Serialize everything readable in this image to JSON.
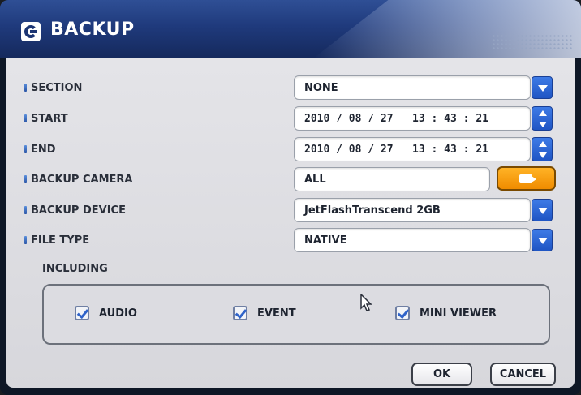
{
  "window": {
    "title": "BACKUP",
    "title_icon": "backup-app-icon",
    "accent_color": "#1f3a7c",
    "button_color": "#2a62d6",
    "camera_button_color": "#f59a0e"
  },
  "form": {
    "section": {
      "label": "SECTION",
      "value": "NONE",
      "control_icon": "chevron-down-icon"
    },
    "start": {
      "label": "START",
      "value": "2010 / 08 / 27   13 : 43 : 21",
      "control_icon": "spin-up-down-icon"
    },
    "end": {
      "label": "END",
      "value": "2010 / 08 / 27   13 : 43 : 21",
      "control_icon": "spin-up-down-icon"
    },
    "backup_camera": {
      "label": "BACKUP CAMERA",
      "value": "ALL",
      "control_icon": "camera-icon"
    },
    "backup_device": {
      "label": "BACKUP DEVICE",
      "value": "JetFlashTranscend 2GB",
      "control_icon": "chevron-down-icon"
    },
    "file_type": {
      "label": "FILE TYPE",
      "value": "NATIVE",
      "control_icon": "chevron-down-icon"
    }
  },
  "including": {
    "label": "INCLUDING",
    "options": [
      {
        "label": "AUDIO",
        "checked": true
      },
      {
        "label": "EVENT",
        "checked": true
      },
      {
        "label": "MINI VIEWER",
        "checked": true
      }
    ]
  },
  "buttons": {
    "ok": "OK",
    "cancel": "CANCEL"
  }
}
